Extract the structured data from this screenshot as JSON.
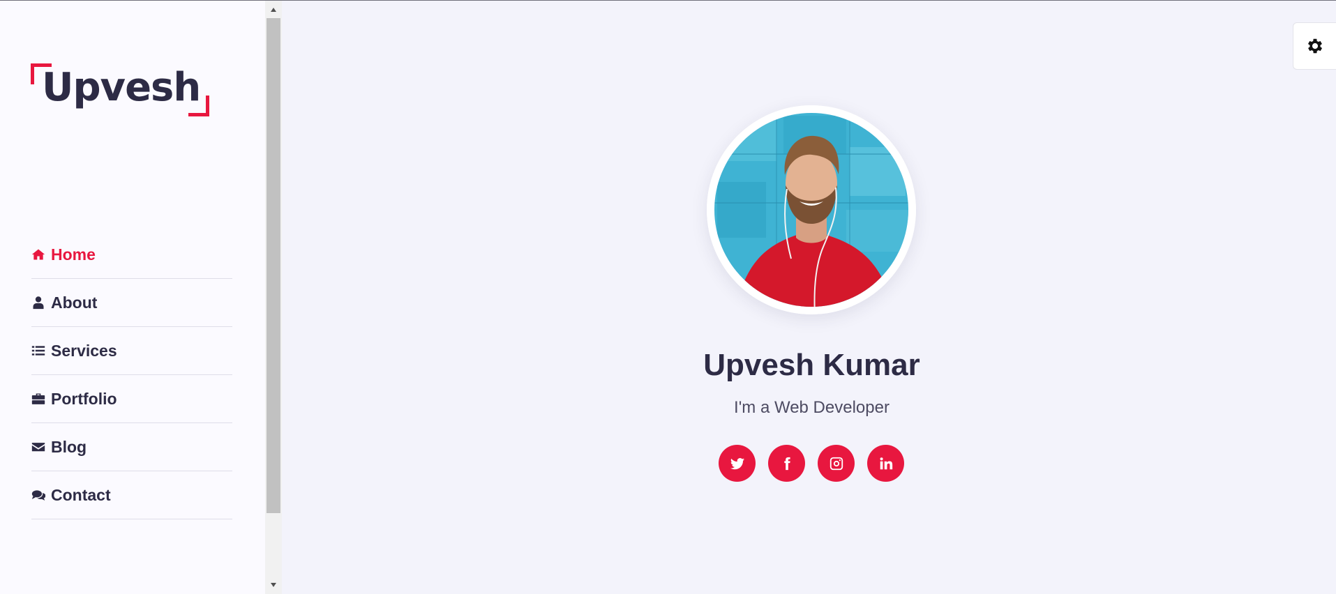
{
  "brand": {
    "logo": "Upvesh",
    "accent_color": "#e8173f",
    "text_color": "#2d2b45"
  },
  "sidebar": {
    "items": [
      {
        "label": "Home",
        "icon": "home-icon",
        "active": true
      },
      {
        "label": "About",
        "icon": "user-icon",
        "active": false
      },
      {
        "label": "Services",
        "icon": "list-icon",
        "active": false
      },
      {
        "label": "Portfolio",
        "icon": "briefcase-icon",
        "active": false
      },
      {
        "label": "Blog",
        "icon": "envelope-icon",
        "active": false
      },
      {
        "label": "Contact",
        "icon": "comments-icon",
        "active": false
      }
    ]
  },
  "hero": {
    "name": "Upvesh Kumar",
    "role": "I'm a Web Developer",
    "socials": [
      {
        "icon": "twitter-icon"
      },
      {
        "icon": "facebook-icon"
      },
      {
        "icon": "instagram-icon"
      },
      {
        "icon": "linkedin-icon"
      }
    ]
  },
  "settings": {
    "icon": "gear-icon"
  }
}
